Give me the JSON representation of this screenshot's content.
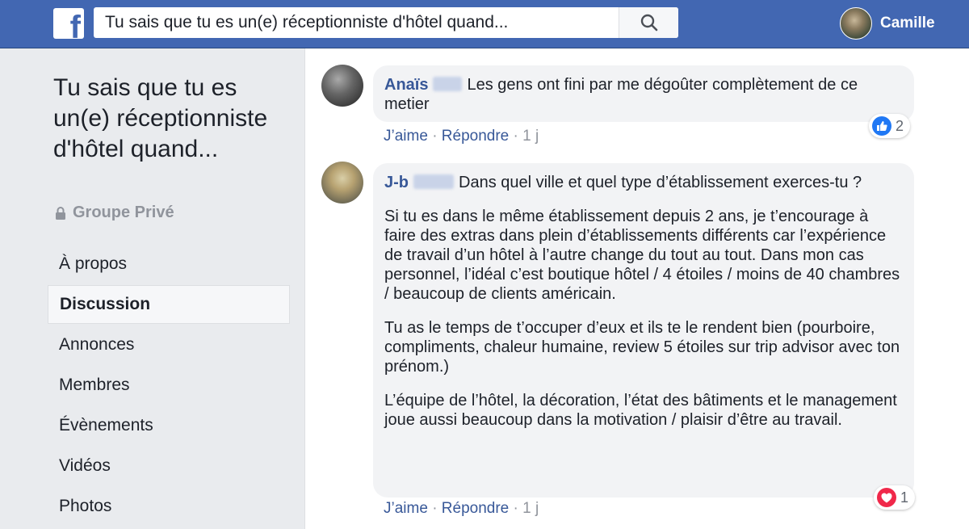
{
  "topbar": {
    "logo_letter": "f",
    "search_value": "Tu sais que tu es un(e) réceptionniste d'hôtel quand...",
    "search_icon": "search-icon",
    "user_name": "Camille",
    "brand_color": "#4267b2"
  },
  "sidebar": {
    "group_title": "Tu sais que tu es un(e) réceptionniste d'hôtel quand...",
    "group_type": "Groupe Privé",
    "nav": [
      {
        "label": "À propos"
      },
      {
        "label": "Discussion"
      },
      {
        "label": "Annonces"
      },
      {
        "label": "Membres"
      },
      {
        "label": "Évènements"
      },
      {
        "label": "Vidéos"
      },
      {
        "label": "Photos"
      }
    ],
    "active_item": "Discussion"
  },
  "comments": [
    {
      "author": "Anaïs",
      "text": "Les gens ont fini par me dégoûter complètement de ce metier",
      "like_label": "J’aime",
      "reply_label": "Répondre",
      "time": "1 j",
      "reaction_type": "like",
      "reaction_count": "2"
    },
    {
      "author": "J-b",
      "paragraphs": [
        "Dans quel ville et quel type d’établissement exerces-tu ?",
        "Si tu es dans le même établissement depuis 2 ans, je t’encourage à faire des extras dans plein d’établissements différents car l’expérience de travail d’un hôtel à l’autre change du tout au tout. Dans mon cas personnel, l’idéal c’est boutique hôtel / 4 étoiles / moins de 40 chambres / beaucoup de clients américain.",
        "Tu as le temps de t’occuper d’eux et ils te le rendent bien (pourboire, compliments, chaleur humaine, review 5 étoiles sur trip advisor avec ton prénom.)",
        "L’équipe de l’hôtel, la décoration, l’état des bâtiments et le management joue aussi beaucoup dans la motivation / plaisir d’être au travail."
      ],
      "like_label": "J’aime",
      "reply_label": "Répondre",
      "time": "1 j",
      "reaction_type": "love",
      "reaction_count": "1"
    }
  ],
  "separator": "·"
}
